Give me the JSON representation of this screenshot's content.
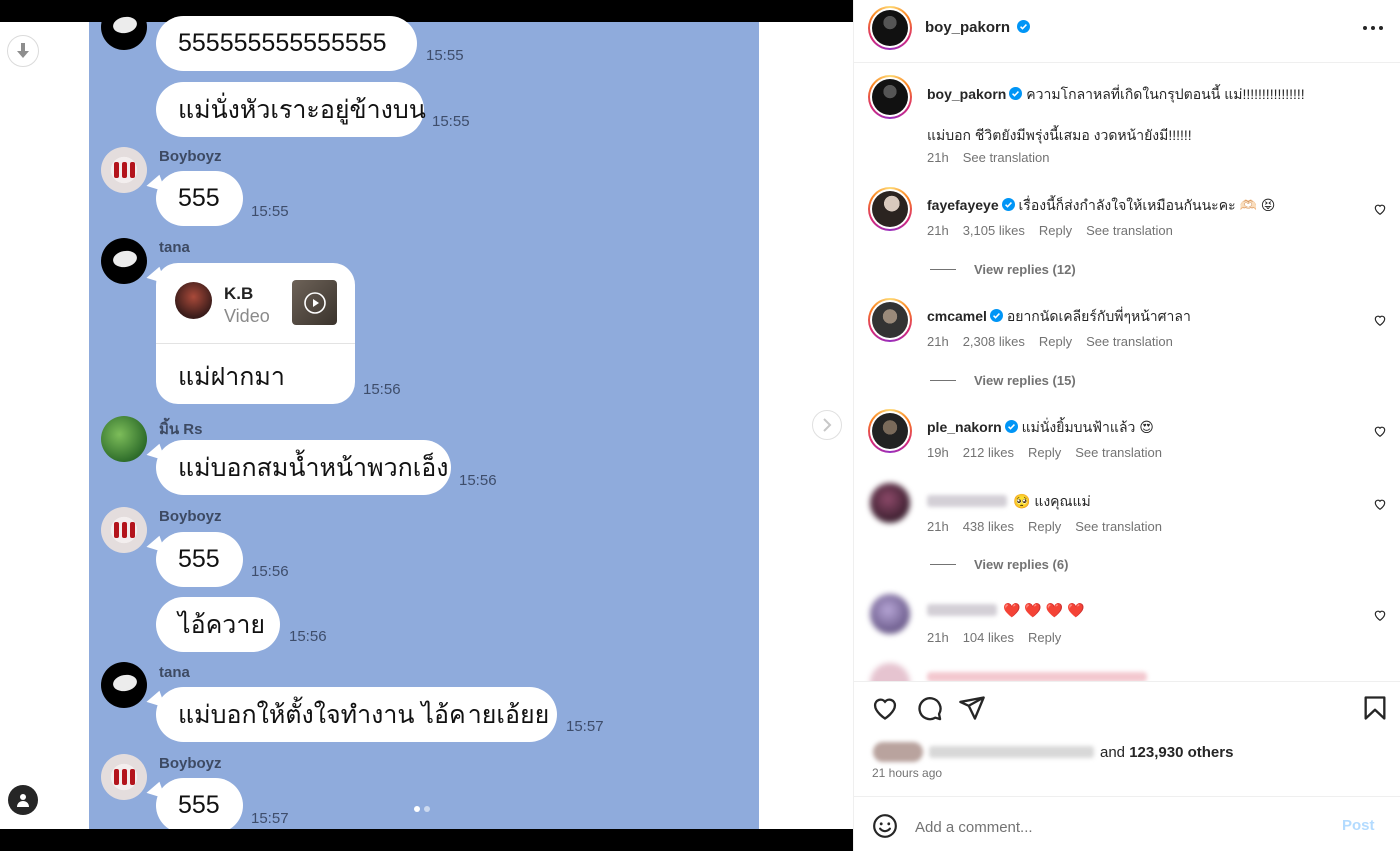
{
  "chat": {
    "messages": [
      {
        "text": "555555555555555",
        "time": "15:55"
      },
      {
        "text": "แม่นั่งหัวเราะอยู่ข้างบน",
        "time": "15:55"
      },
      {
        "sender": "Boyboyz",
        "text": "555",
        "time": "15:55"
      },
      {
        "sender": "tana",
        "card_title": "K.B",
        "card_subtitle": "Video",
        "text": "แม่ฝากมา",
        "time": "15:56"
      },
      {
        "sender": "มิ้น Rs",
        "text": "แม่บอกสมน้ำหน้าพวกเอ็ง",
        "time": "15:56"
      },
      {
        "sender": "Boyboyz",
        "text": "555",
        "time": "15:56"
      },
      {
        "text": "ไอ้ควาย",
        "time": "15:56"
      },
      {
        "sender": "tana",
        "text_a": "แม่บอกให้ตั้งใจทำงาน ไอ้ค",
        "text_b": "ายเอ้ยย",
        "time": "15:57"
      },
      {
        "sender": "Boyboyz",
        "text": "555",
        "time": "15:57"
      }
    ],
    "carousel_index": 1,
    "carousel_total": 2
  },
  "post": {
    "author": "boy_pakorn",
    "caption_line1": "ความโกลาหลที่เกิดในกรุปตอนนี้ แม่!!!!!!!!!!!!!!!!",
    "caption_line2": "แม่บอก ชีวิตยังมีพรุ่งนี้เสมอ งวดหน้ายังมี!!!!!!",
    "caption_time": "21h",
    "see_translation": "See translation"
  },
  "comments": [
    {
      "user": "fayefayeye",
      "text": "เรื่องนี้ก็ส่งกำลังใจให้เหมือนกันนะคะ 🫶🏻 😝",
      "time": "21h",
      "likes": "3,105 likes",
      "reply": "Reply",
      "translate": "See translation",
      "view_replies": "View replies (12)"
    },
    {
      "user": "cmcamel",
      "text": "อยากนัดเคลียร์กับพี่ๆหน้าศาลา",
      "time": "21h",
      "likes": "2,308 likes",
      "reply": "Reply",
      "translate": "See translation",
      "view_replies": "View replies (15)"
    },
    {
      "user": "ple_nakorn",
      "text": "แม่นั่งยิ้มบนฟ้าแล้ว 😍",
      "time": "19h",
      "likes": "212 likes",
      "reply": "Reply",
      "translate": "See translation"
    },
    {
      "text": "🥺 แงคุณแม่",
      "time": "21h",
      "likes": "438 likes",
      "reply": "Reply",
      "translate": "See translation",
      "view_replies": "View replies (6)"
    },
    {
      "text": "❤️ ❤️ ❤️ ❤️",
      "time": "21h",
      "likes": "104 likes",
      "reply": "Reply"
    }
  ],
  "likes": {
    "and_text": "and",
    "count": "123,930 others",
    "ago": "21 hours ago"
  },
  "add_comment": {
    "placeholder": "Add a comment...",
    "post_label": "Post"
  },
  "colors": {
    "chat_bg": "#8fabdc",
    "verified": "#0095f6",
    "post_disabled": "#b3dbff"
  }
}
